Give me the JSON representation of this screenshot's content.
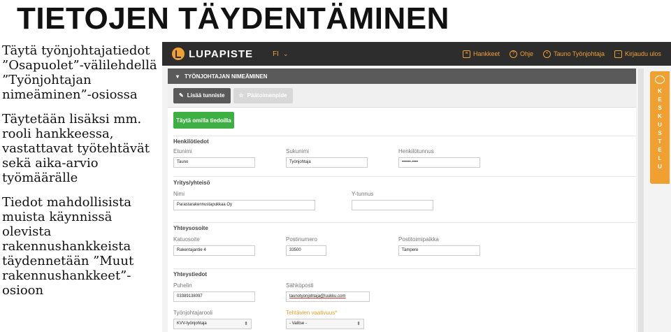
{
  "slide": {
    "title": "TIETOJEN TÄYDENTÄMINEN",
    "paragraph1": "Täytä työnjohtajatiedot ”Osapuolet”-välilehdellä ”Työnjohtajan nimeäminen”-osiossa",
    "paragraph2": "Täytetään lisäksi mm. rooli hankkeessa, vastattavat työtehtävät sekä aika-arvio työmäärälle",
    "paragraph3": "Tiedot mahdollisista muista käynnissä olevista rakennushankkeista täydennetään ”Muut rakennushankkeet”-osioon"
  },
  "app": {
    "logo": "LUPAPISTE",
    "language": "FI",
    "nav": [
      {
        "label": "Hankkeet",
        "icon": "document-icon"
      },
      {
        "label": "Ohje",
        "icon": "help-icon"
      },
      {
        "label": "Tauno Työnjohtaja",
        "icon": "user-icon"
      },
      {
        "label": "Kirjaudu ulos",
        "icon": "logout-icon"
      }
    ],
    "panel_title": "TYÖNJOHTAJAN NIMEÄMINEN",
    "toolbar": {
      "add_stamp": "Lisää tunniste",
      "main_designer": "Päätoimenpide"
    },
    "fill_own_info": "Täytä omilla tiedoilla",
    "personal": {
      "title": "Henkilötiedot",
      "first_name_label": "Etunimi",
      "first_name": "Tauno",
      "last_name_label": "Sukunimi",
      "last_name": "Työnjohtaja",
      "ssn_label": "Henkilötunnus",
      "ssn": "••••••-••••"
    },
    "company": {
      "title": "Yritys/yhteisö",
      "name_label": "Nimi",
      "name": "Parastarakennustapukkaa Oy",
      "ytunnus_label": "Y-tunnus",
      "ytunnus": ""
    },
    "address": {
      "title": "Yhteysosoite",
      "street_label": "Katuosoite",
      "street": "Rakentajantie 4",
      "zip_label": "Postinumero",
      "zip": "33500",
      "city_label": "Postitoimipaikka",
      "city": "Tampere"
    },
    "contact": {
      "title": "Yhteystiedot",
      "phone_label": "Puhelin",
      "phone": "03389138097",
      "email_label": "Sähköposti",
      "email": "taunotyonjohtaja@luukku.com",
      "role_label": "Työnjohtajarooli",
      "role": "KVV-työnjohtaja",
      "difficulty_label": "Tehtävien vaativuus*",
      "difficulty": "- Valitse -"
    },
    "side_tab": [
      "K",
      "E",
      "S",
      "K",
      "U",
      "S",
      "T",
      "E",
      "L",
      "U"
    ],
    "accent_color": "#f0a030",
    "green_color": "#3cb043"
  }
}
